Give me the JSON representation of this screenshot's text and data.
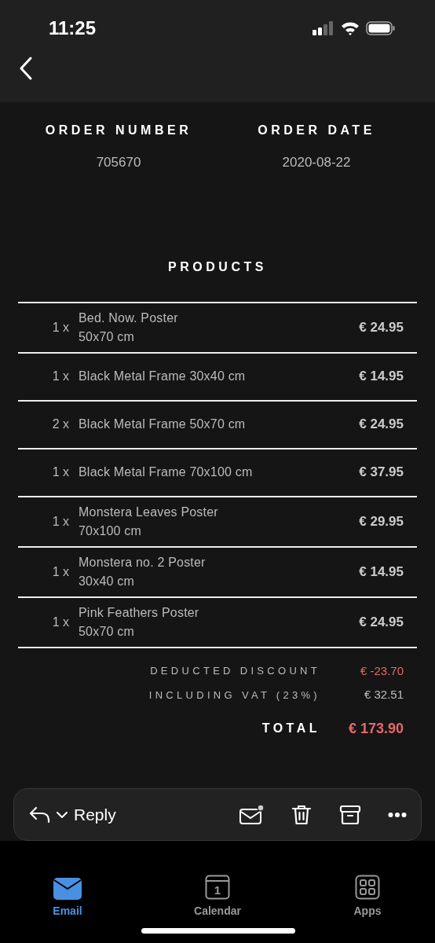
{
  "status_bar": {
    "time": "11:25"
  },
  "order": {
    "fields": [
      {
        "label": "ORDER NUMBER",
        "value": "705670"
      },
      {
        "label": "ORDER DATE",
        "value": "2020-08-22"
      }
    ]
  },
  "products": {
    "title": "PRODUCTS",
    "rows": [
      {
        "qty": "1 x",
        "name": "Bed. Now. Poster",
        "size": "50x70 cm",
        "price": "€ 24.95"
      },
      {
        "qty": "1 x",
        "name": "Black Metal Frame 30x40 cm",
        "price": "€ 14.95"
      },
      {
        "qty": "2 x",
        "name": "Black Metal Frame 50x70 cm",
        "price": "€ 24.95"
      },
      {
        "qty": "1 x",
        "name": "Black Metal Frame 70x100 cm",
        "price": "€ 37.95"
      },
      {
        "qty": "1 x",
        "name": "Monstera Leaves Poster",
        "size": "70x100 cm",
        "price": "€ 29.95"
      },
      {
        "qty": "1 x",
        "name": "Monstera no. 2 Poster",
        "size": "30x40 cm",
        "price": "€ 14.95"
      },
      {
        "qty": "1 x",
        "name": "Pink Feathers Poster",
        "size": "50x70 cm",
        "price": "€ 24.95"
      }
    ]
  },
  "summary": [
    {
      "kind": "discount",
      "label": "DEDUCTED DISCOUNT",
      "value": "€ -23.70"
    },
    {
      "kind": "plain",
      "label": "INCLUDING VAT (23%)",
      "value": "€ 32.51"
    },
    {
      "kind": "total",
      "label": "TOTAL",
      "value": "€ 173.90"
    }
  ],
  "toolbar": {
    "reply_label": "Reply"
  },
  "tabs": [
    {
      "kind": "email",
      "label": "Email",
      "selected": true
    },
    {
      "kind": "calendar",
      "label": "Calendar",
      "icon_text": "1",
      "selected": false
    },
    {
      "kind": "apps",
      "label": "Apps",
      "selected": false
    }
  ]
}
